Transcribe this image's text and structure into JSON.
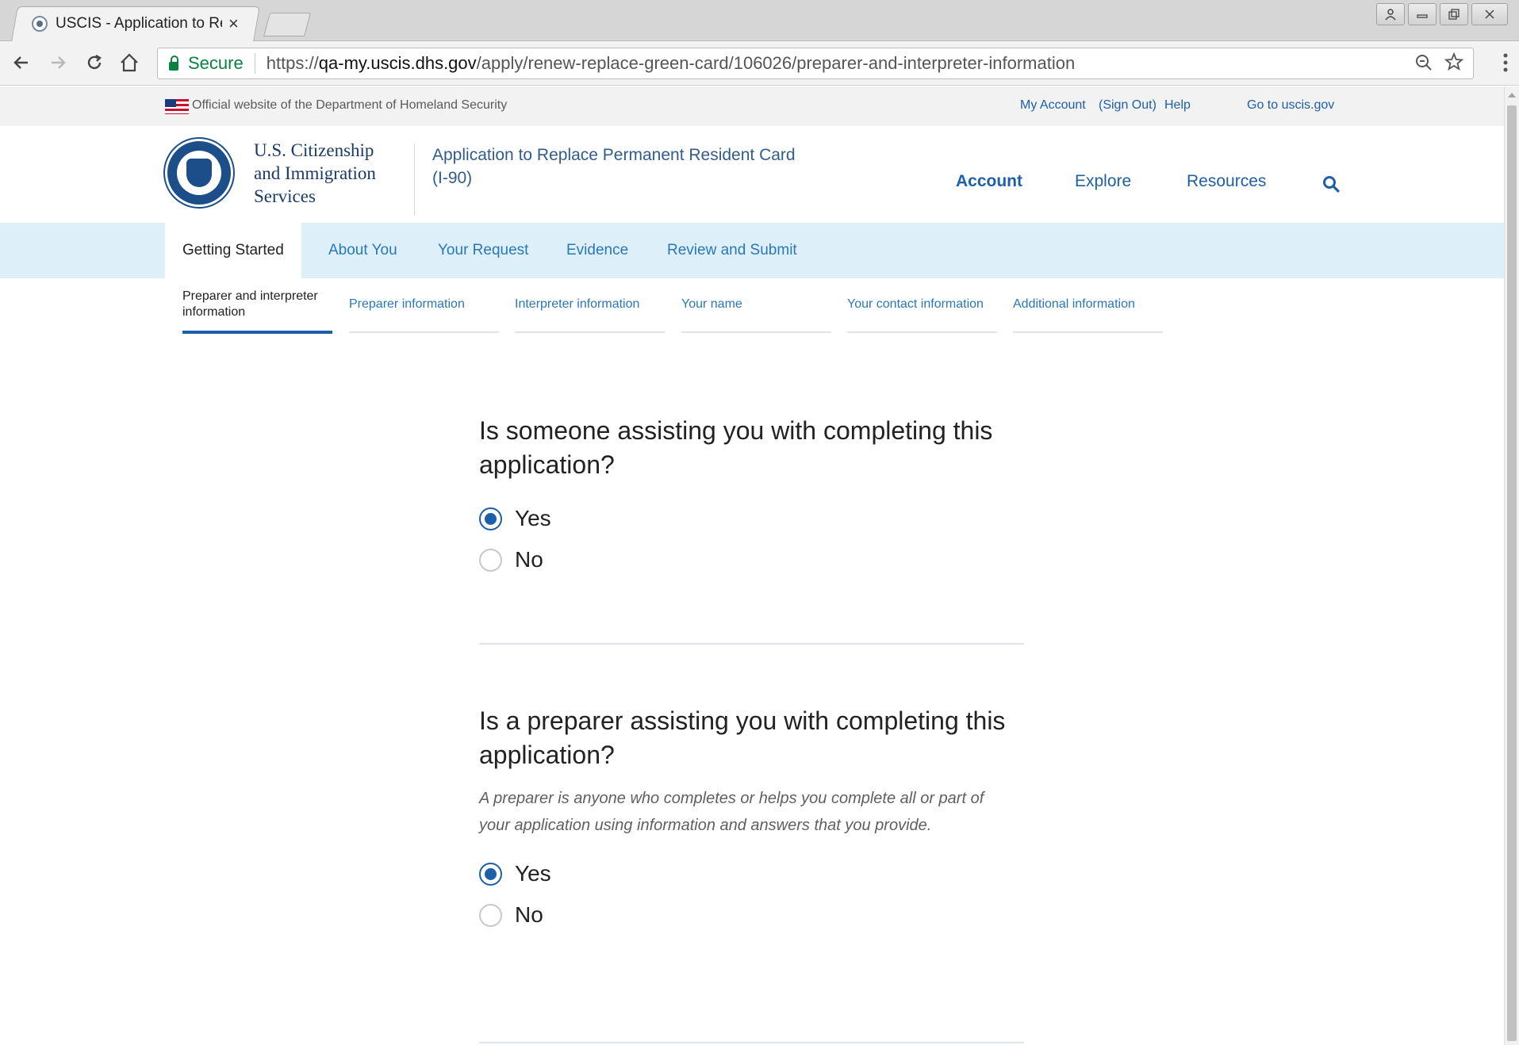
{
  "browser": {
    "tab_title": "USCIS - Application to Re",
    "tab_close": "×",
    "secure_label": "Secure",
    "url_scheme": "https://",
    "url_host": "qa-my.uscis.dhs.gov",
    "url_path": "/apply/renew-replace-green-card/106026/preparer-and-interpreter-information"
  },
  "govbar": {
    "official_text": "Official website of the Department of Homeland Security",
    "my_account": "My Account",
    "sign_out": "(Sign Out)",
    "help": "Help",
    "go_to": "Go to uscis.gov"
  },
  "header": {
    "agency_line1": "U.S. Citizenship",
    "agency_line2": "and Immigration",
    "agency_line3": "Services",
    "app_title": "Application to Replace Permanent Resident Card (I-90)",
    "nav": [
      "Account",
      "Explore",
      "Resources"
    ]
  },
  "steps": [
    "Getting Started",
    "About You",
    "Your Request",
    "Evidence",
    "Review and Submit"
  ],
  "active_step": "Getting Started",
  "substeps": [
    "Preparer and interpreter information",
    "Preparer information",
    "Interpreter information",
    "Your name",
    "Your contact information",
    "Additional information"
  ],
  "questions": [
    {
      "text": "Is someone assisting you with completing this application?",
      "help": "",
      "options": [
        "Yes",
        "No"
      ],
      "selected": "Yes"
    },
    {
      "text": "Is a preparer assisting you with completing this application?",
      "help": "A preparer is anyone who completes or helps you complete all or part of your application using information and answers that you provide.",
      "options": [
        "Yes",
        "No"
      ],
      "selected": "Yes"
    }
  ],
  "colors": {
    "link_blue": "#1d5fa8",
    "stepbar_bg": "#ddf0fa",
    "secure_green": "#0b8043"
  }
}
